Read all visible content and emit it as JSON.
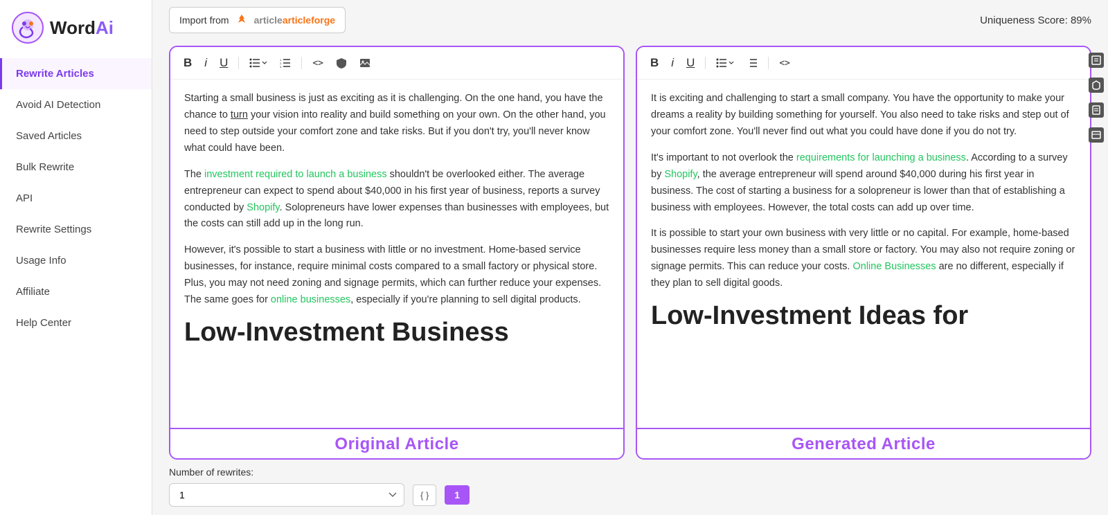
{
  "sidebar": {
    "logo_word": "Word",
    "logo_ai": "Ai",
    "nav_items": [
      {
        "id": "rewrite-articles",
        "label": "Rewrite Articles",
        "active": true
      },
      {
        "id": "avoid-ai-detection",
        "label": "Avoid AI Detection",
        "active": false
      },
      {
        "id": "saved-articles",
        "label": "Saved Articles",
        "active": false
      },
      {
        "id": "bulk-rewrite",
        "label": "Bulk Rewrite",
        "active": false
      },
      {
        "id": "api",
        "label": "API",
        "active": false
      },
      {
        "id": "rewrite-settings",
        "label": "Rewrite Settings",
        "active": false
      },
      {
        "id": "usage-info",
        "label": "Usage Info",
        "active": false
      },
      {
        "id": "affiliate",
        "label": "Affiliate",
        "active": false
      },
      {
        "id": "help-center",
        "label": "Help Center",
        "active": false
      }
    ]
  },
  "topbar": {
    "import_label": "Import from",
    "articleforge_text": "articleforge",
    "uniqueness_label": "Uniqueness Score: 89%"
  },
  "original_article": {
    "label": "Original Article",
    "content_paragraphs": [
      "Starting a small business is just as exciting as it is challenging. On the one hand, you have the chance to turn your vision into reality and build something on your own. On the other hand, you need to step outside your comfort zone and take risks. But if you don't try, you'll never know what could have been.",
      "The {investment required to launch a business} shouldn't be overlooked either. The average entrepreneur can expect to spend about $40,000 in his first year of business, reports a survey conducted by {Shopify}. Solopreneurs have lower expenses than businesses with employees, but the costs can still add up in the long run.",
      "However, it's possible to start a business with little or no investment. Home-based service businesses, for instance, require minimal costs compared to a small factory or physical store. Plus, you may not need zoning and signage permits, which can further reduce your expenses. The same goes for {online businesses}, especially if you're planning to sell digital products."
    ],
    "big_heading": "Low-Investment Business",
    "link1": "investment required to launch a business",
    "link2": "Shopify",
    "link3": "online businesses"
  },
  "generated_article": {
    "label": "Generated Article",
    "content_paragraphs": [
      "It is exciting and challenging to start a small company. You have the opportunity to make your dreams a reality by building something for yourself. You also need to take risks and step out of your comfort zone. You'll never find out what you could have done if you do not try.",
      "It's important to not overlook the {requirements for launching a business}. According to a survey by {Shopify}, the average entrepreneur will spend around $40,000 during his first year in business. The cost of starting a business for a solopreneur is lower than that of establishing a business with employees. However, the total costs can add up over time.",
      "It is possible to start your own business with very little or no capital. For example, home-based businesses require less money than a small store or factory. You may also not require zoning or signage permits. This can reduce your costs. {Online Businesses} are no different, especially if they plan to sell digital goods."
    ],
    "big_heading": "Low-Investment Ideas for",
    "link1": "requirements for launching a business",
    "link2": "Shopify",
    "link3": "Online Businesses"
  },
  "bottombar": {
    "num_rewrites_label": "Number of rewrites:",
    "select_value": "1",
    "json_btn_label": "{ }",
    "num_badge": "1"
  },
  "toolbar": {
    "bold": "B",
    "italic": "i",
    "underline": "U",
    "list": "≡",
    "ordered_list": "≡",
    "code": "<>",
    "shield": "🛡",
    "image": "🖼"
  },
  "colors": {
    "purple": "#a855f7",
    "green_link": "#22c55e",
    "active_nav": "#7c3aed"
  }
}
